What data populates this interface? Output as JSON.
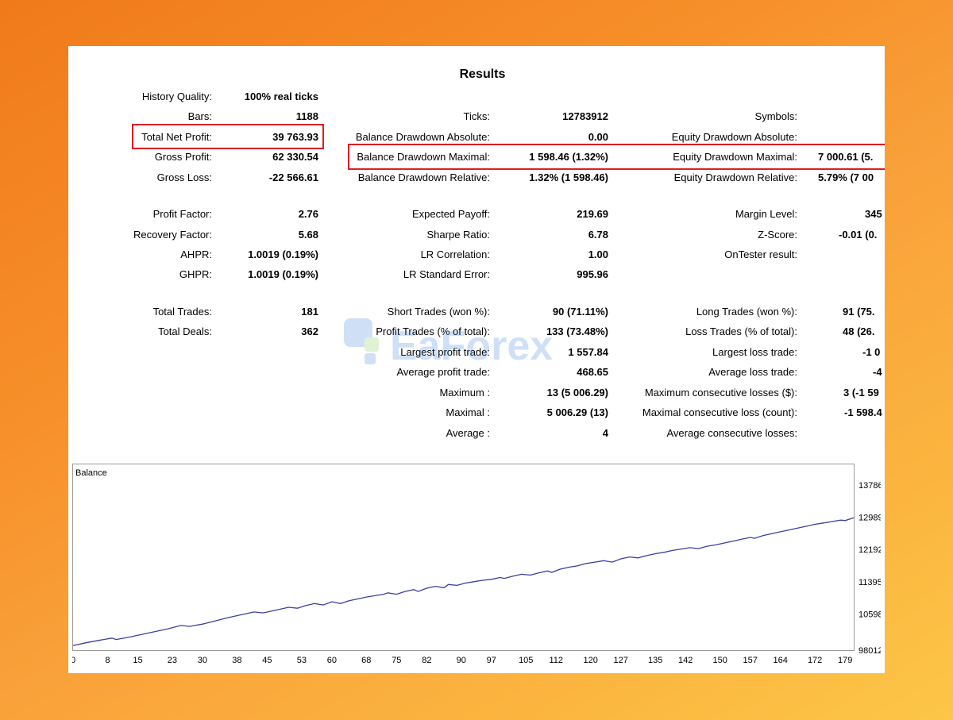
{
  "title": "Results",
  "rows": [
    {
      "label": "History Quality:",
      "value": "100% real ticks"
    },
    {
      "label": "Bars:",
      "value": "1188"
    },
    {
      "label": "Total Net Profit:",
      "value": "39 763.93"
    },
    {
      "label": "Gross Profit:",
      "value": "62 330.54"
    },
    {
      "label": "Gross Loss:",
      "value": "-22 566.61"
    },
    {
      "label": "Ticks:",
      "value": "12783912"
    },
    {
      "label": "Balance Drawdown Absolute:",
      "value": "0.00"
    },
    {
      "label": "Balance Drawdown Maximal:",
      "value": "1 598.46 (1.32%)"
    },
    {
      "label": "Balance Drawdown Relative:",
      "value": "1.32% (1 598.46)"
    },
    {
      "label": "Symbols:",
      "value": ""
    },
    {
      "label": "Equity Drawdown Absolute:",
      "value": ""
    },
    {
      "label": "Equity Drawdown Maximal:",
      "value": "7 000.61 (5."
    },
    {
      "label": "Equity Drawdown Relative:",
      "value": "5.79% (7 00"
    },
    {
      "label": "Profit Factor:",
      "value": "2.76"
    },
    {
      "label": "Recovery Factor:",
      "value": "5.68"
    },
    {
      "label": "AHPR:",
      "value": "1.0019 (0.19%)"
    },
    {
      "label": "GHPR:",
      "value": "1.0019 (0.19%)"
    },
    {
      "label": "Expected Payoff:",
      "value": "219.69"
    },
    {
      "label": "Sharpe Ratio:",
      "value": "6.78"
    },
    {
      "label": "LR Correlation:",
      "value": "1.00"
    },
    {
      "label": "LR Standard Error:",
      "value": "995.96"
    },
    {
      "label": "Margin Level:",
      "value": "345"
    },
    {
      "label": "Z-Score:",
      "value": "-0.01 (0."
    },
    {
      "label": "OnTester result:",
      "value": ""
    },
    {
      "label": "Total Trades:",
      "value": "181"
    },
    {
      "label": "Total Deals:",
      "value": "362"
    },
    {
      "label": "Short Trades (won %):",
      "value": "90 (71.11%)"
    },
    {
      "label": "Profit Trades (% of total):",
      "value": "133 (73.48%)"
    },
    {
      "label": "Largest profit trade:",
      "value": "1 557.84"
    },
    {
      "label": "Average profit trade:",
      "value": "468.65"
    },
    {
      "label": "Maximum :",
      "value": "13 (5 006.29)"
    },
    {
      "label": "Maximal :",
      "value": "5 006.29 (13)"
    },
    {
      "label": "Average :",
      "value": "4"
    },
    {
      "label": "Long Trades (won %):",
      "value": "91 (75."
    },
    {
      "label": "Loss Trades (% of total):",
      "value": "48 (26."
    },
    {
      "label": "Largest loss trade:",
      "value": "-1 0"
    },
    {
      "label": "Average loss trade:",
      "value": "-4"
    },
    {
      "label": "Maximum consecutive losses ($):",
      "value": "3 (-1 59"
    },
    {
      "label": "Maximal consecutive loss (count):",
      "value": "-1 598.4"
    },
    {
      "label": "Average consecutive losses:",
      "value": ""
    }
  ],
  "chart_label": "Balance",
  "watermark_text": "EaForex",
  "colors": {
    "highlight": "#e01b24",
    "line": "#3a3fa0",
    "grid": "#9a9a9a"
  },
  "chart_data": {
    "type": "line",
    "title": "Balance",
    "x_ticks": [
      "0",
      "8",
      "15",
      "23",
      "30",
      "38",
      "45",
      "53",
      "60",
      "68",
      "75",
      "82",
      "90",
      "97",
      "105",
      "112",
      "120",
      "127",
      "135",
      "142",
      "150",
      "157",
      "164",
      "172",
      "179"
    ],
    "y_ticks": [
      "98012",
      "10598",
      "11395",
      "12192",
      "12989",
      "13786"
    ],
    "ylim": [
      9801.2,
      13786
    ],
    "xlim": [
      0,
      181
    ],
    "series": [
      {
        "values": [
          [
            0,
            9900
          ],
          [
            3,
            9960
          ],
          [
            6,
            10010
          ],
          [
            9,
            10060
          ],
          [
            10,
            10030
          ],
          [
            13,
            10080
          ],
          [
            16,
            10140
          ],
          [
            19,
            10200
          ],
          [
            22,
            10260
          ],
          [
            25,
            10330
          ],
          [
            27,
            10310
          ],
          [
            30,
            10360
          ],
          [
            33,
            10430
          ],
          [
            36,
            10500
          ],
          [
            39,
            10560
          ],
          [
            42,
            10620
          ],
          [
            44,
            10600
          ],
          [
            47,
            10660
          ],
          [
            50,
            10720
          ],
          [
            52,
            10700
          ],
          [
            54,
            10760
          ],
          [
            56,
            10800
          ],
          [
            58,
            10770
          ],
          [
            60,
            10840
          ],
          [
            62,
            10800
          ],
          [
            64,
            10860
          ],
          [
            66,
            10900
          ],
          [
            68,
            10940
          ],
          [
            70,
            10970
          ],
          [
            72,
            11000
          ],
          [
            73,
            11030
          ],
          [
            75,
            11000
          ],
          [
            77,
            11060
          ],
          [
            79,
            11100
          ],
          [
            80,
            11060
          ],
          [
            82,
            11130
          ],
          [
            84,
            11170
          ],
          [
            86,
            11140
          ],
          [
            87,
            11210
          ],
          [
            89,
            11190
          ],
          [
            91,
            11240
          ],
          [
            93,
            11270
          ],
          [
            95,
            11300
          ],
          [
            97,
            11320
          ],
          [
            99,
            11360
          ],
          [
            100,
            11340
          ],
          [
            102,
            11390
          ],
          [
            104,
            11430
          ],
          [
            106,
            11410
          ],
          [
            108,
            11460
          ],
          [
            110,
            11500
          ],
          [
            111,
            11470
          ],
          [
            113,
            11540
          ],
          [
            115,
            11580
          ],
          [
            117,
            11610
          ],
          [
            119,
            11660
          ],
          [
            121,
            11690
          ],
          [
            123,
            11720
          ],
          [
            125,
            11690
          ],
          [
            127,
            11760
          ],
          [
            129,
            11800
          ],
          [
            131,
            11780
          ],
          [
            133,
            11830
          ],
          [
            135,
            11870
          ],
          [
            137,
            11900
          ],
          [
            139,
            11940
          ],
          [
            141,
            11970
          ],
          [
            143,
            12000
          ],
          [
            145,
            11980
          ],
          [
            147,
            12030
          ],
          [
            149,
            12060
          ],
          [
            151,
            12100
          ],
          [
            153,
            12140
          ],
          [
            155,
            12180
          ],
          [
            157,
            12220
          ],
          [
            158,
            12200
          ],
          [
            160,
            12260
          ],
          [
            162,
            12300
          ],
          [
            164,
            12340
          ],
          [
            166,
            12380
          ],
          [
            168,
            12420
          ],
          [
            170,
            12460
          ],
          [
            172,
            12500
          ],
          [
            174,
            12530
          ],
          [
            176,
            12560
          ],
          [
            178,
            12590
          ],
          [
            179,
            12580
          ],
          [
            181,
            12640
          ]
        ]
      }
    ]
  }
}
